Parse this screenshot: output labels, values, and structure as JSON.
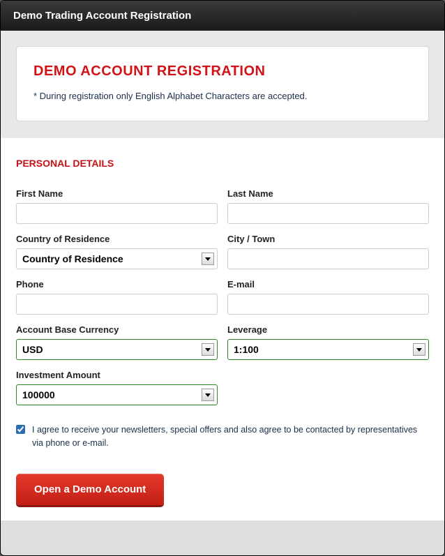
{
  "window": {
    "title": "Demo Trading Account Registration"
  },
  "notice": {
    "title": "DEMO ACCOUNT REGISTRATION",
    "text": "* During registration only English Alphabet Characters are accepted."
  },
  "section": {
    "title": "PERSONAL DETAILS"
  },
  "fields": {
    "first_name": {
      "label": "First Name",
      "value": ""
    },
    "last_name": {
      "label": "Last Name",
      "value": ""
    },
    "country": {
      "label": "Country of Residence",
      "value": "Country of Residence"
    },
    "city": {
      "label": "City / Town",
      "value": ""
    },
    "phone": {
      "label": "Phone",
      "value": ""
    },
    "email": {
      "label": "E-mail",
      "value": ""
    },
    "currency": {
      "label": "Account Base Currency",
      "value": "USD"
    },
    "leverage": {
      "label": "Leverage",
      "value": "1:100"
    },
    "amount": {
      "label": "Investment Amount",
      "value": "100000"
    }
  },
  "agree": {
    "checked": true,
    "text": "I agree to receive your newsletters, special offers and also agree to be contacted by representatives via phone or e-mail."
  },
  "submit": {
    "label": "Open a Demo Account"
  }
}
